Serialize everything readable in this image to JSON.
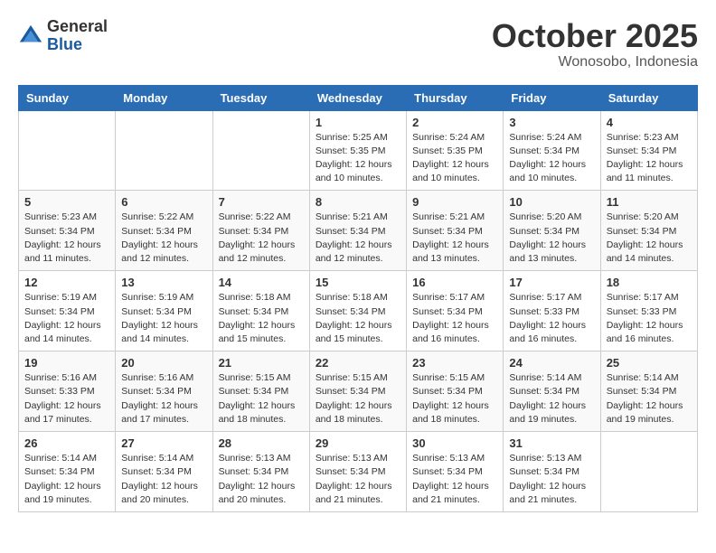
{
  "logo": {
    "general": "General",
    "blue": "Blue"
  },
  "header": {
    "month": "October 2025",
    "location": "Wonosobo, Indonesia"
  },
  "weekdays": [
    "Sunday",
    "Monday",
    "Tuesday",
    "Wednesday",
    "Thursday",
    "Friday",
    "Saturday"
  ],
  "weeks": [
    [
      {
        "day": "",
        "info": ""
      },
      {
        "day": "",
        "info": ""
      },
      {
        "day": "",
        "info": ""
      },
      {
        "day": "1",
        "info": "Sunrise: 5:25 AM\nSunset: 5:35 PM\nDaylight: 12 hours\nand 10 minutes."
      },
      {
        "day": "2",
        "info": "Sunrise: 5:24 AM\nSunset: 5:35 PM\nDaylight: 12 hours\nand 10 minutes."
      },
      {
        "day": "3",
        "info": "Sunrise: 5:24 AM\nSunset: 5:34 PM\nDaylight: 12 hours\nand 10 minutes."
      },
      {
        "day": "4",
        "info": "Sunrise: 5:23 AM\nSunset: 5:34 PM\nDaylight: 12 hours\nand 11 minutes."
      }
    ],
    [
      {
        "day": "5",
        "info": "Sunrise: 5:23 AM\nSunset: 5:34 PM\nDaylight: 12 hours\nand 11 minutes."
      },
      {
        "day": "6",
        "info": "Sunrise: 5:22 AM\nSunset: 5:34 PM\nDaylight: 12 hours\nand 12 minutes."
      },
      {
        "day": "7",
        "info": "Sunrise: 5:22 AM\nSunset: 5:34 PM\nDaylight: 12 hours\nand 12 minutes."
      },
      {
        "day": "8",
        "info": "Sunrise: 5:21 AM\nSunset: 5:34 PM\nDaylight: 12 hours\nand 12 minutes."
      },
      {
        "day": "9",
        "info": "Sunrise: 5:21 AM\nSunset: 5:34 PM\nDaylight: 12 hours\nand 13 minutes."
      },
      {
        "day": "10",
        "info": "Sunrise: 5:20 AM\nSunset: 5:34 PM\nDaylight: 12 hours\nand 13 minutes."
      },
      {
        "day": "11",
        "info": "Sunrise: 5:20 AM\nSunset: 5:34 PM\nDaylight: 12 hours\nand 14 minutes."
      }
    ],
    [
      {
        "day": "12",
        "info": "Sunrise: 5:19 AM\nSunset: 5:34 PM\nDaylight: 12 hours\nand 14 minutes."
      },
      {
        "day": "13",
        "info": "Sunrise: 5:19 AM\nSunset: 5:34 PM\nDaylight: 12 hours\nand 14 minutes."
      },
      {
        "day": "14",
        "info": "Sunrise: 5:18 AM\nSunset: 5:34 PM\nDaylight: 12 hours\nand 15 minutes."
      },
      {
        "day": "15",
        "info": "Sunrise: 5:18 AM\nSunset: 5:34 PM\nDaylight: 12 hours\nand 15 minutes."
      },
      {
        "day": "16",
        "info": "Sunrise: 5:17 AM\nSunset: 5:34 PM\nDaylight: 12 hours\nand 16 minutes."
      },
      {
        "day": "17",
        "info": "Sunrise: 5:17 AM\nSunset: 5:33 PM\nDaylight: 12 hours\nand 16 minutes."
      },
      {
        "day": "18",
        "info": "Sunrise: 5:17 AM\nSunset: 5:33 PM\nDaylight: 12 hours\nand 16 minutes."
      }
    ],
    [
      {
        "day": "19",
        "info": "Sunrise: 5:16 AM\nSunset: 5:33 PM\nDaylight: 12 hours\nand 17 minutes."
      },
      {
        "day": "20",
        "info": "Sunrise: 5:16 AM\nSunset: 5:34 PM\nDaylight: 12 hours\nand 17 minutes."
      },
      {
        "day": "21",
        "info": "Sunrise: 5:15 AM\nSunset: 5:34 PM\nDaylight: 12 hours\nand 18 minutes."
      },
      {
        "day": "22",
        "info": "Sunrise: 5:15 AM\nSunset: 5:34 PM\nDaylight: 12 hours\nand 18 minutes."
      },
      {
        "day": "23",
        "info": "Sunrise: 5:15 AM\nSunset: 5:34 PM\nDaylight: 12 hours\nand 18 minutes."
      },
      {
        "day": "24",
        "info": "Sunrise: 5:14 AM\nSunset: 5:34 PM\nDaylight: 12 hours\nand 19 minutes."
      },
      {
        "day": "25",
        "info": "Sunrise: 5:14 AM\nSunset: 5:34 PM\nDaylight: 12 hours\nand 19 minutes."
      }
    ],
    [
      {
        "day": "26",
        "info": "Sunrise: 5:14 AM\nSunset: 5:34 PM\nDaylight: 12 hours\nand 19 minutes."
      },
      {
        "day": "27",
        "info": "Sunrise: 5:14 AM\nSunset: 5:34 PM\nDaylight: 12 hours\nand 20 minutes."
      },
      {
        "day": "28",
        "info": "Sunrise: 5:13 AM\nSunset: 5:34 PM\nDaylight: 12 hours\nand 20 minutes."
      },
      {
        "day": "29",
        "info": "Sunrise: 5:13 AM\nSunset: 5:34 PM\nDaylight: 12 hours\nand 21 minutes."
      },
      {
        "day": "30",
        "info": "Sunrise: 5:13 AM\nSunset: 5:34 PM\nDaylight: 12 hours\nand 21 minutes."
      },
      {
        "day": "31",
        "info": "Sunrise: 5:13 AM\nSunset: 5:34 PM\nDaylight: 12 hours\nand 21 minutes."
      },
      {
        "day": "",
        "info": ""
      }
    ]
  ]
}
